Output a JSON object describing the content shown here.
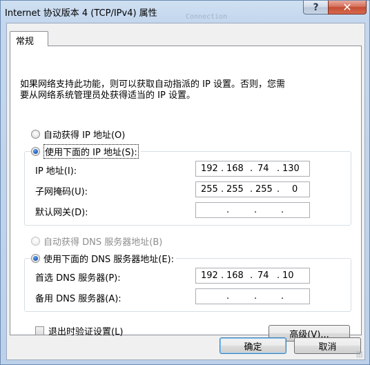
{
  "window": {
    "title": "Internet 协议版本 4 (TCP/IPv4) 属性",
    "ghost_text": "Connection",
    "help_label": "?",
    "close_label": "✕"
  },
  "tab": {
    "label": "常规"
  },
  "description": "如果网络支持此功能，则可以获取自动指派的 IP 设置。否则，您需\n要从网络系统管理员处获得适当的 IP 设置。",
  "ip": {
    "auto_label": "自动获得 IP 地址(O)",
    "manual_label": "使用下面的 IP 地址(S):",
    "address_label": "IP 地址(I):",
    "address": [
      "192",
      "168",
      "74",
      "130"
    ],
    "subnet_label": "子网掩码(U):",
    "subnet": [
      "255",
      "255",
      "255",
      "0"
    ],
    "gateway_label": "默认网关(D):",
    "gateway": [
      "",
      "",
      "",
      ""
    ]
  },
  "dns": {
    "auto_label": "自动获得 DNS 服务器地址(B)",
    "manual_label": "使用下面的 DNS 服务器地址(E):",
    "preferred_label": "首选 DNS 服务器(P):",
    "preferred": [
      "192",
      "168",
      "74",
      "10"
    ],
    "alternate_label": "备用 DNS 服务器(A):",
    "alternate": [
      "",
      "",
      "",
      ""
    ]
  },
  "validate_label": "退出时验证设置(L)",
  "advanced_label": "高级(V)...",
  "ok_label": "确定",
  "cancel_label": "取消",
  "separator": "."
}
